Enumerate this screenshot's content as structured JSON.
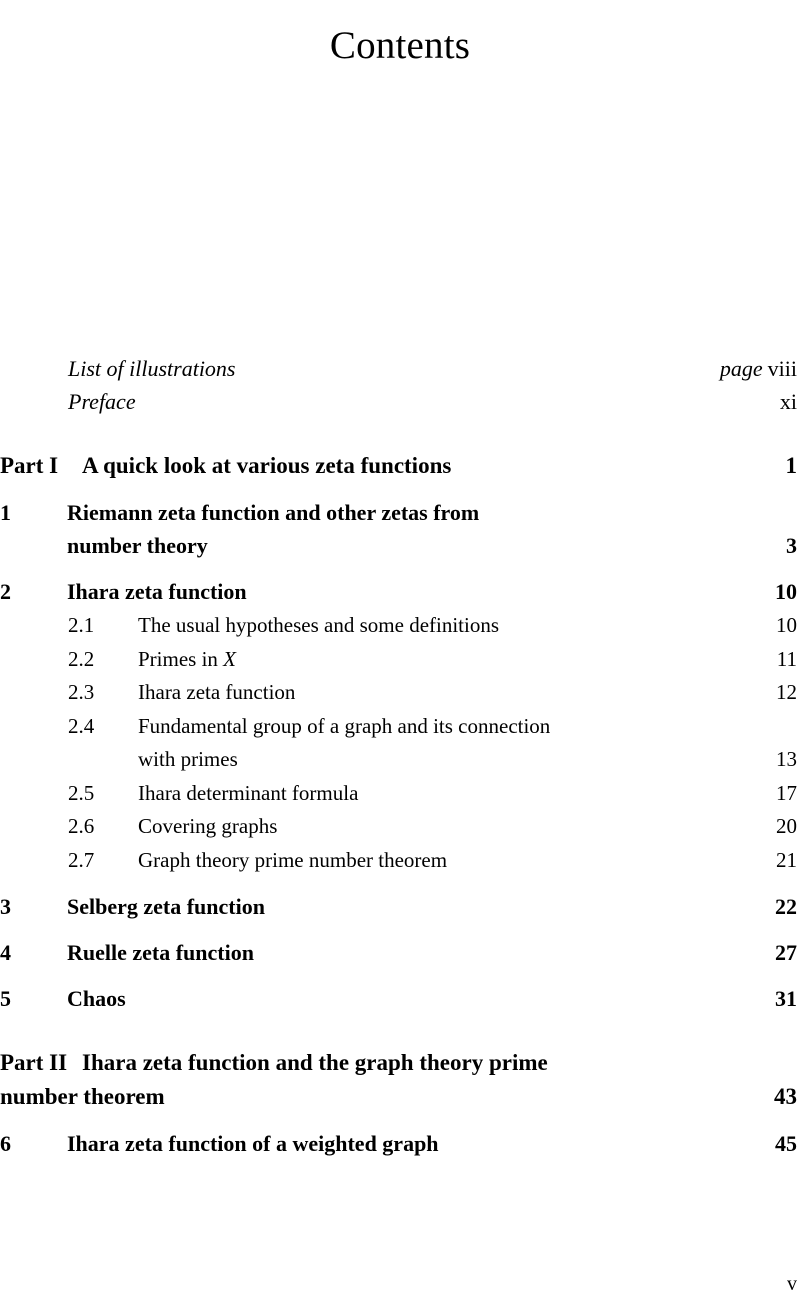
{
  "title": "Contents",
  "front_matter": [
    {
      "label": "List of illustrations",
      "page_label": "page",
      "page": "viii"
    },
    {
      "label": "Preface",
      "page_label": "",
      "page": "xi"
    }
  ],
  "parts": [
    {
      "part_number": "Part I",
      "part_title": "A quick look at various zeta functions",
      "part_title_cont": "",
      "page": "1",
      "chapters": [
        {
          "number": "1",
          "title": "Riemann zeta function and other zetas from",
          "title_cont": "number theory",
          "page": "3",
          "sections": []
        },
        {
          "number": "2",
          "title": "Ihara zeta function",
          "title_cont": "",
          "page": "10",
          "sections": [
            {
              "number": "2.1",
              "title": "The usual hypotheses and some definitions",
              "title_cont": "",
              "page": "10"
            },
            {
              "number": "2.2",
              "title": "Primes in ",
              "title_math": "X",
              "title_cont": "",
              "page": "11"
            },
            {
              "number": "2.3",
              "title": "Ihara zeta function",
              "title_cont": "",
              "page": "12"
            },
            {
              "number": "2.4",
              "title": "Fundamental group of a graph and its connection",
              "title_cont": "with primes",
              "page": "13"
            },
            {
              "number": "2.5",
              "title": "Ihara determinant formula",
              "title_cont": "",
              "page": "17"
            },
            {
              "number": "2.6",
              "title": "Covering graphs",
              "title_cont": "",
              "page": "20"
            },
            {
              "number": "2.7",
              "title": "Graph theory prime number theorem",
              "title_cont": "",
              "page": "21"
            }
          ]
        },
        {
          "number": "3",
          "title": "Selberg zeta function",
          "title_cont": "",
          "page": "22",
          "sections": []
        },
        {
          "number": "4",
          "title": "Ruelle zeta function",
          "title_cont": "",
          "page": "27",
          "sections": []
        },
        {
          "number": "5",
          "title": "Chaos",
          "title_cont": "",
          "page": "31",
          "sections": []
        }
      ]
    },
    {
      "part_number": "Part II",
      "part_title": "Ihara zeta function and the graph theory prime",
      "part_title_cont": "number theorem",
      "page": "43",
      "chapters": [
        {
          "number": "6",
          "title": "Ihara zeta function of a weighted graph",
          "title_cont": "",
          "page": "45",
          "sections": []
        }
      ]
    }
  ],
  "folio": "v"
}
